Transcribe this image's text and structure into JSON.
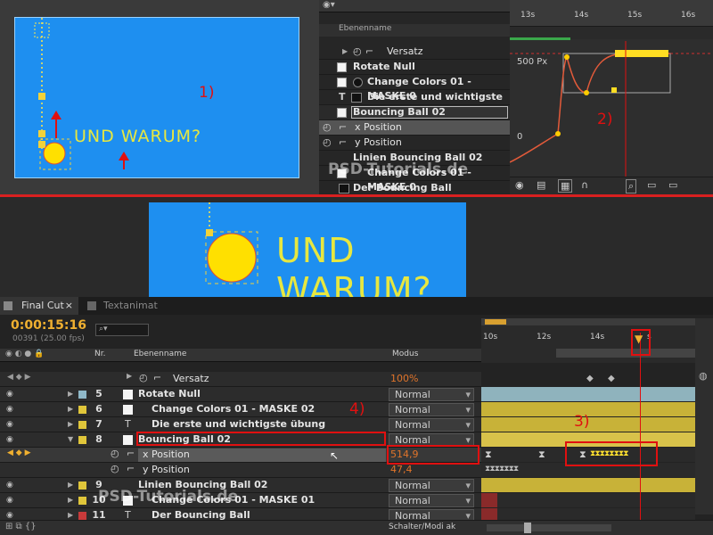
{
  "top_preview": {
    "comp_text": "UND WARUM?",
    "annotation": "1)"
  },
  "top_layers": {
    "header": "Ebenenname",
    "rows": [
      {
        "label": "Versatz"
      },
      {
        "label": "Rotate Null"
      },
      {
        "label": "Change Colors 01 - MASKE 0"
      },
      {
        "label": "Die erste und wichtigste übu"
      },
      {
        "label": "Bouncing Ball 02"
      },
      {
        "label": "x Position"
      },
      {
        "label": "y Position"
      },
      {
        "label": "Linien Bouncing Ball 02"
      },
      {
        "label": "Change Colors 01 - MASKE 0"
      },
      {
        "label": "Der Bouncing Ball"
      }
    ],
    "watermark": "PSD-Tutorials.de"
  },
  "graph": {
    "ticks": [
      "13s",
      "14s",
      "15s",
      "16s"
    ],
    "y_top": "500 Px",
    "y_zero": "0",
    "annotation": "2)"
  },
  "mid_preview": {
    "comp_text": "UND WARUM?"
  },
  "timeline": {
    "tabs": [
      "Final Cut",
      "Textanimat"
    ],
    "timecode": "0:00:15:16",
    "frames": "00391 (25.00 fps)",
    "col_nr": "Nr.",
    "col_name": "Ebenenname",
    "col_mode": "Modus",
    "ruler": [
      "10s",
      "12s",
      "14s",
      "s"
    ],
    "versatz": {
      "label": "Versatz",
      "value": "100",
      "unit": "%"
    },
    "layers": [
      {
        "num": "5",
        "name": "Rotate Null",
        "mode": "Normal",
        "color": "#8fb8c8"
      },
      {
        "num": "6",
        "name": "Change Colors 01 - MASKE 02",
        "mode": "Normal",
        "color": "#e0c63a"
      },
      {
        "num": "7",
        "name": "Die erste und wichtigste übung",
        "mode": "Normal",
        "color": "#e0c63a"
      },
      {
        "num": "8",
        "name": "Bouncing Ball 02",
        "mode": "Normal",
        "color": "#e0c63a"
      }
    ],
    "props": [
      {
        "name": "x Position",
        "value": "514,9"
      },
      {
        "name": "y Position",
        "value": "47,4"
      }
    ],
    "layers_after": [
      {
        "num": "9",
        "name": "Linien Bouncing Ball 02",
        "mode": "Normal",
        "color": "#e0c63a"
      },
      {
        "num": "10",
        "name": "Change Colors 01 - MASKE 01",
        "mode": "Normal",
        "color": "#e0c63a"
      },
      {
        "num": "11",
        "name": "Der Bouncing Ball",
        "mode": "Normal",
        "color": "#c83a3a"
      }
    ],
    "annot_3": "3)",
    "annot_4": "4)",
    "footer": "Schalter/Modi ak",
    "watermark": "PSD-Tutorials.de"
  }
}
